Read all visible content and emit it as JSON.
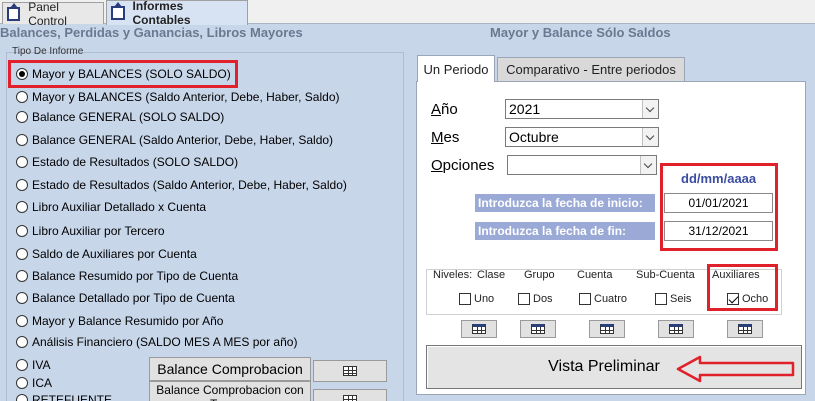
{
  "tabs": [
    {
      "label": "Panel Control",
      "active": false
    },
    {
      "label": "Informes Contables",
      "active": true
    }
  ],
  "left_title": "Balances, Perdidas y Ganancias, Libros Mayores",
  "right_title": "Mayor y Balance Sólo Saldos",
  "report_type": {
    "group_label": "Tipo De Informe",
    "options": [
      {
        "label": "Mayor y BALANCES (SOLO SALDO)",
        "checked": true
      },
      {
        "label": "Mayor y BALANCES (Saldo Anterior, Debe, Haber, Saldo)",
        "checked": false
      },
      {
        "label": "Balance GENERAL (SOLO SALDO)",
        "checked": false
      },
      {
        "label": "Balance GENERAL (Saldo Anterior, Debe, Haber, Saldo)",
        "checked": false
      },
      {
        "label": "Estado de Resultados (SOLO SALDO)",
        "checked": false
      },
      {
        "label": "Estado de Resultados (Saldo Anterior, Debe, Haber, Saldo)",
        "checked": false
      },
      {
        "label": "Libro Auxiliar Detallado x Cuenta",
        "checked": false
      },
      {
        "label": "Libro Auxiliar por Tercero",
        "checked": false
      },
      {
        "label": "Saldo de Auxiliares por Cuenta",
        "checked": false
      },
      {
        "label": "Balance Resumido por Tipo de Cuenta",
        "checked": false
      },
      {
        "label": "Balance Detallado por Tipo de Cuenta",
        "checked": false
      },
      {
        "label": "Mayor y Balance Resumido por Año",
        "checked": false
      },
      {
        "label": "Análisis Financiero (SALDO MES A MES por año)",
        "checked": false
      },
      {
        "label": "IVA",
        "checked": false
      },
      {
        "label": "ICA",
        "checked": false
      },
      {
        "label": "RETEFUENTE",
        "checked": false
      }
    ]
  },
  "buttons": {
    "balance_comprobacion": "Balance Comprobacion",
    "balance_comprobacion_tercero": "Balance Comprobacion con Tercero",
    "vista_preliminar": "Vista Preliminar"
  },
  "period_tabs": [
    {
      "label": "Un Periodo",
      "active": true
    },
    {
      "label": "Comparativo - Entre periodos",
      "active": false
    }
  ],
  "form": {
    "ano_label": "Año",
    "ano_underline": "A",
    "ano_rest": "ño",
    "ano_value": "2021",
    "mes_label": "Mes",
    "mes_underline": "M",
    "mes_rest": "es",
    "mes_value": "Octubre",
    "opciones_label": "Opciones",
    "opciones_underline": "O",
    "opciones_rest": "pciones",
    "opciones_value": "",
    "date_format": "dd/mm/aaaa",
    "fecha_inicio_label": "Introduzca la fecha de inicio:",
    "fecha_inicio_value": "01/01/2021",
    "fecha_fin_label": "Introduzca la fecha de fin:",
    "fecha_fin_value": "31/12/2021"
  },
  "niveles": {
    "title": "Niveles:",
    "headers": [
      "Clase",
      "Grupo",
      "Cuenta",
      "Sub-Cuenta",
      "Auxiliares"
    ],
    "checks": [
      {
        "label": "Uno",
        "checked": false
      },
      {
        "label": "Dos",
        "checked": false
      },
      {
        "label": "Cuatro",
        "checked": false
      },
      {
        "label": "Seis",
        "checked": false
      },
      {
        "label": "Ocho",
        "checked": true
      }
    ]
  },
  "colors": {
    "highlight_red": "#e0202a",
    "date_label_bg": "#9aa9d6",
    "background": "#c8d6ea"
  }
}
